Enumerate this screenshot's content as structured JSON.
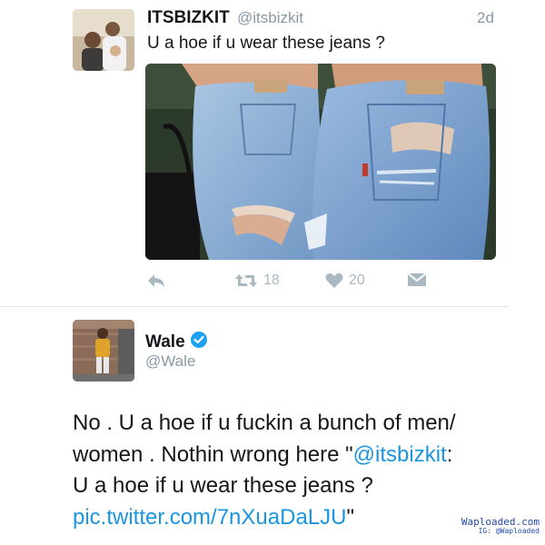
{
  "tweet1": {
    "display_name": "ITSBIZKIT",
    "handle": "@itsbizkit",
    "time": "2d",
    "text": "U a hoe if u wear these jeans ?",
    "retweet_count": "18",
    "like_count": "20",
    "icons": [
      "reply-icon",
      "retweet-icon",
      "heart-icon",
      "message-icon"
    ]
  },
  "tweet2": {
    "display_name": "Wale",
    "handle": "@Wale",
    "verified": true,
    "body_line1": "No . U a hoe if u fuckin a bunch of men/",
    "body_line2_pre": "women . Nothin wrong here \"",
    "mention": "@itsbizkit",
    "body_line2_post": ":",
    "body_line3": "U a hoe if u wear these jeans ?",
    "link": "pic.twitter.com/7nXuaDaLJU",
    "link_suffix": "\""
  },
  "watermark": {
    "line1": "Waploaded.com",
    "line2": "IG: @Waploaded"
  },
  "colors": {
    "link": "#1b95e0",
    "verified": "#1da1f2",
    "muted": "#8899a6",
    "icon": "#aab8c2"
  }
}
